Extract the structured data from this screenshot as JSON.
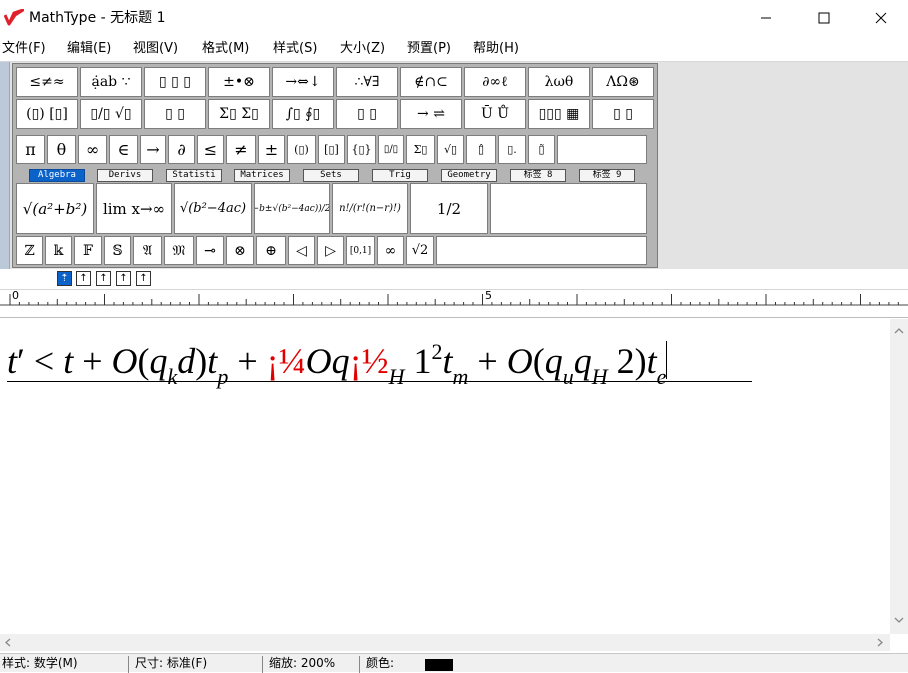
{
  "window": {
    "title": "MathType - 无标题 1",
    "min_glyph": "—",
    "max_glyph": "☐",
    "close_glyph": "✕"
  },
  "menu": [
    "文件(F)",
    "编辑(E)",
    "视图(V)",
    "格式(M)",
    "样式(S)",
    "大小(Z)",
    "预置(P)",
    "帮助(H)"
  ],
  "palette": {
    "row1": [
      "≤≠≈",
      "ạ̇ab ∵",
      "▯ ▯ ▯",
      "±•⊗",
      "→⇔↓",
      "∴∀∃",
      "∉∩⊂",
      "∂∞ℓ",
      "λωθ",
      "ΛΩ⊛"
    ],
    "row2": [
      "(▯) [▯]",
      "▯/▯ √▯",
      "▯ ▯",
      "Σ▯ Σ▯",
      "∫▯ ∮▯",
      "▯ ▯",
      "→ ⇌",
      "Ū Ů",
      "▯▯▯ ▦",
      "▯ ▯"
    ],
    "row3": [
      "π",
      "θ",
      "∞",
      "∈",
      "→",
      "∂",
      "≤",
      "≠",
      "±",
      "(▯)",
      "[▯]",
      "{▯}",
      "▯/▯",
      "Σ▯",
      "√▯",
      "▯̂",
      "▯.",
      "▯̃"
    ],
    "tabs": [
      "Algebra",
      "Derivs",
      "Statisti",
      "Matrices",
      "Sets",
      "Trig",
      "Geometry",
      "标签 8",
      "标签 9"
    ],
    "active_tab": "Algebra",
    "templates": [
      "√(a²+b²)",
      "lim x→∞",
      "√(b²−4ac)",
      "(−b±√(b²−4ac))/2a",
      "n!/(r!(n−r)!)",
      "1/2"
    ],
    "row5": [
      "ℤ",
      "𝕜",
      "𝔽",
      "𝕊",
      "𝔄",
      "𝔐",
      "⊸",
      "⊗",
      "⊕",
      "◁",
      "▷",
      "[0,1]",
      "∞",
      "√2"
    ],
    "size_buttons": [
      "⇡",
      "↑",
      "↑",
      "↑",
      "↑"
    ]
  },
  "ruler": {
    "label_0": "0",
    "label_5": "5"
  },
  "equation": {
    "t1": "t",
    "prime": "′",
    "lt": " < ",
    "t2": "t",
    "plus1": " + ",
    "O1": "O",
    "p1": "(",
    "q1": "q",
    "k": "k",
    "d": "d",
    "p2": ")",
    "t3": "t",
    "p": "p",
    "plus2": " + ",
    "junk1": "¡¼",
    "O2": "O",
    "q2": "q",
    "junk2": "¡½",
    "H1": "H",
    "one": " 1",
    "two_sup": "2",
    "t4": "t",
    "m": "m",
    "plus3": " + ",
    "O3": "O",
    "p3": "(",
    "q3": "q",
    "u": "u",
    "q4": "q",
    "H2": "H",
    "two": " 2",
    "p4": ")",
    "t5": "t",
    "e": "e"
  },
  "status": {
    "style": "样式: 数学(M)",
    "size": "尺寸: 标准(F)",
    "zoom": "缩放: 200%",
    "color_label": "颜色:",
    "color_value": "#000000"
  },
  "colors": {
    "accent": "#0b62c9",
    "logo": "#e0202a",
    "error_text": "#e00000"
  }
}
